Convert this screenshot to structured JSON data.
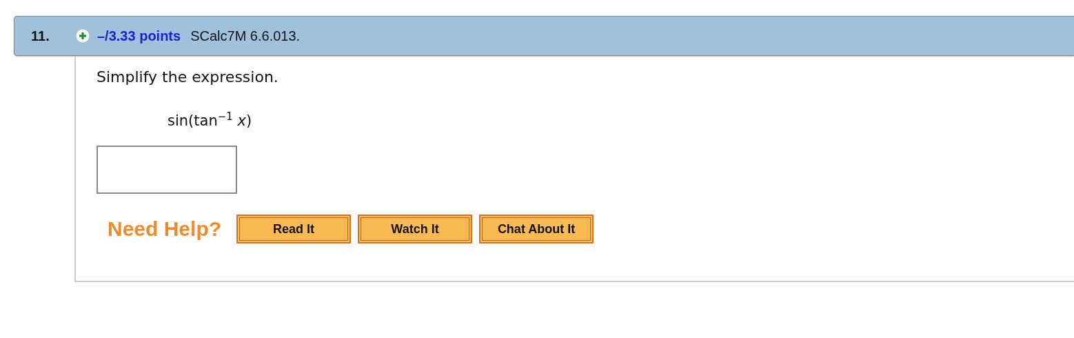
{
  "question": {
    "number": "11.",
    "points": "–/3.33 points",
    "source": "SCalc7M 6.6.013."
  },
  "prompt": "Simplify the expression.",
  "expression": "sin(tan$^{−1}$ *x*)",
  "help": {
    "label": "Need Help?",
    "buttons": [
      "Read It",
      "Watch It",
      "Chat About It"
    ]
  }
}
